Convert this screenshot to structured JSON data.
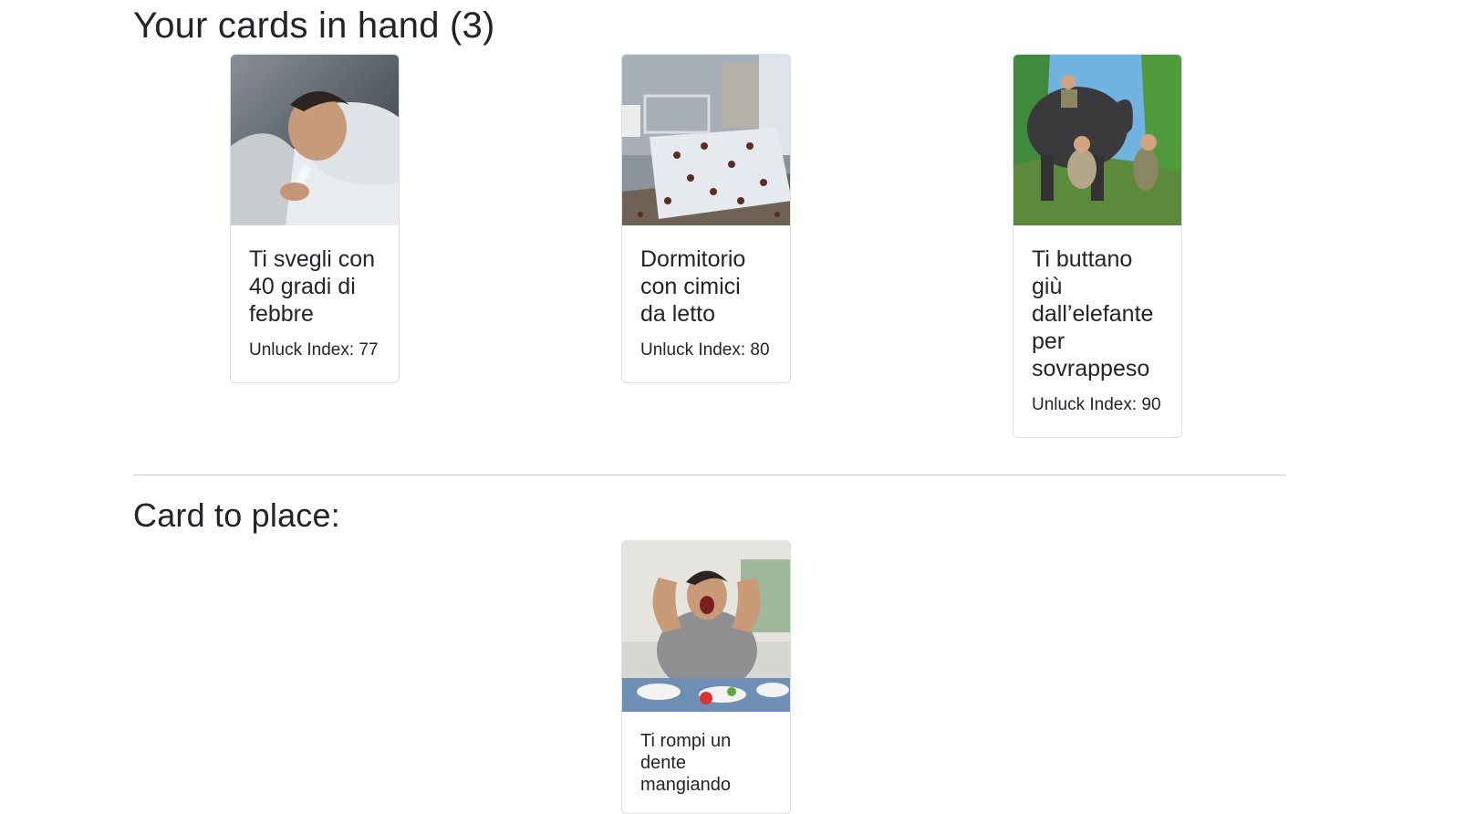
{
  "hand": {
    "heading": "Your cards in hand (3)",
    "cards": [
      {
        "title": "Ti svegli con 40 gradi di febbre",
        "index_text": "Unluck Index: 77",
        "image_icon": "sick-in-bed-image"
      },
      {
        "title": "Dormitorio con cimici da letto",
        "index_text": "Unluck Index: 80",
        "image_icon": "bedbugs-bed-image"
      },
      {
        "title": "Ti buttano giù dall’elefante per sovrappeso",
        "index_text": "Unluck Index: 90",
        "image_icon": "elephant-jungle-image"
      }
    ]
  },
  "place": {
    "heading": "Card to place:",
    "card": {
      "title": "Ti rompi un dente mangiando",
      "image_icon": "broken-tooth-image"
    }
  }
}
